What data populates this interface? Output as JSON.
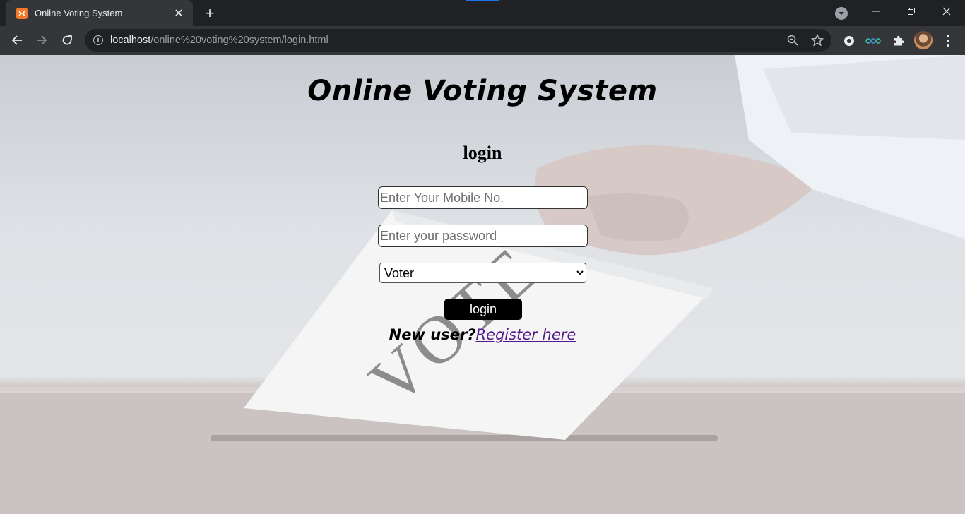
{
  "browser": {
    "tab_title": "Online Voting System",
    "tab_close": "✕",
    "new_tab": "+",
    "url_host": "localhost",
    "url_path": "/online%20voting%20system/login.html"
  },
  "page": {
    "site_title": "Online Voting System",
    "login_heading": "login",
    "mobile_placeholder": "Enter Your Mobile No.",
    "password_placeholder": "Enter your password",
    "role_selected": "Voter",
    "login_button": "login",
    "new_user_text": "New user?",
    "register_link": "Register here",
    "background_text": "VOTE"
  },
  "colors": {
    "link": "#551a8b",
    "button_bg": "#000000",
    "chrome_dark": "#202124",
    "chrome_toolbar": "#35363a"
  }
}
